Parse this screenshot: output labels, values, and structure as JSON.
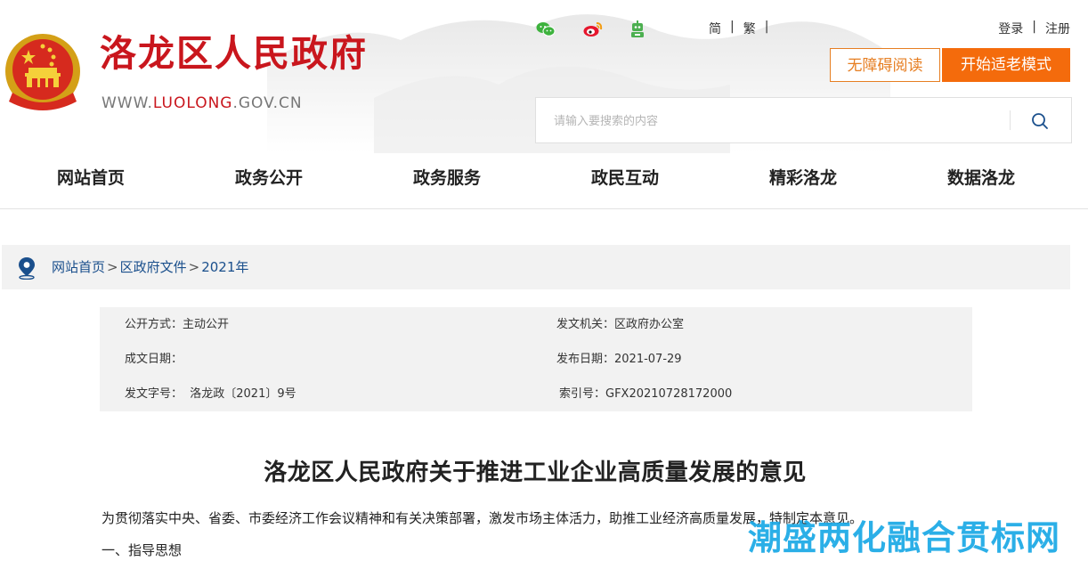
{
  "header": {
    "site_title": "洛龙区人民政府",
    "site_url_prefix": "WWW.",
    "site_url_highlight": "LUOLONG",
    "site_url_suffix": ".GOV.CN",
    "lang_simplified": "简",
    "lang_traditional": "繁",
    "login": "登录",
    "register": "注册",
    "accessible_button": "无障碍阅读",
    "elder_mode_button": "开始适老模式",
    "search_placeholder": "请输入要搜索的内容",
    "social_icons": [
      "wechat-icon",
      "weibo-icon",
      "robot-icon"
    ],
    "colors": {
      "brand_red": "#c9161d",
      "accent_orange": "#f46b0c",
      "social_green": "#3db23d"
    }
  },
  "nav": {
    "items": [
      "网站首页",
      "政务公开",
      "政务服务",
      "政民互动",
      "精彩洛龙",
      "数据洛龙"
    ]
  },
  "breadcrumb": {
    "items": [
      "网站首页",
      "区政府文件",
      "2021年"
    ],
    "separator": ">"
  },
  "meta": {
    "disclosure_method": "公开方式：主动公开",
    "issuing_authority": "发文机关：区政府办公室",
    "creation_date": "成文日期：",
    "publish_date": "发布日期：2021-07-29",
    "document_number": "发文字号：  洛龙政〔2021〕9号",
    "index_number": "索引号：GFX20210728172000"
  },
  "article": {
    "title": "洛龙区人民政府关于推进工业企业高质量发展的意见",
    "paragraphs": [
      "为贯彻落实中央、省委、市委经济工作会议精神和有关决策部署，激发市场主体活力，助推工业经济高质量发展，特制定本意见。",
      "一、指导思想"
    ]
  },
  "watermark": "潮盛两化融合贯标网"
}
